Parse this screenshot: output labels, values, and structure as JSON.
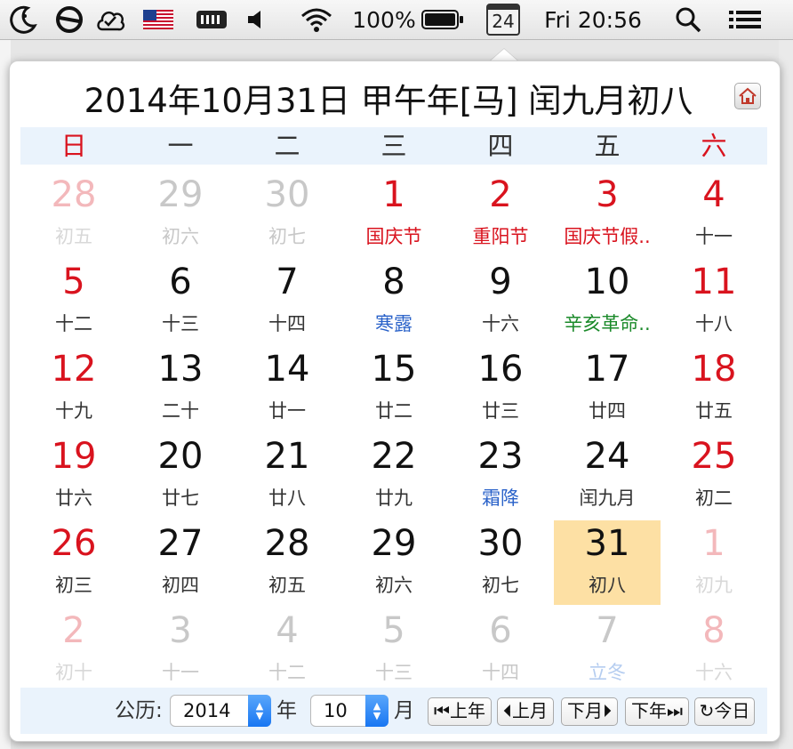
{
  "menubar": {
    "battery_percent": "100%",
    "calendar_icon_day": "24",
    "clock": "Fri 20:56"
  },
  "popup": {
    "title": "2014年10月31日 甲午年[马] 闰九月初八"
  },
  "weekdays": [
    "日",
    "一",
    "二",
    "三",
    "四",
    "五",
    "六"
  ],
  "weeks": [
    [
      {
        "day": "28",
        "lunar": "初五",
        "type": "other red"
      },
      {
        "day": "29",
        "lunar": "初六",
        "type": "other"
      },
      {
        "day": "30",
        "lunar": "初七",
        "type": "other"
      },
      {
        "day": "1",
        "lunar": "国庆节",
        "type": "red hol"
      },
      {
        "day": "2",
        "lunar": "重阳节",
        "type": "red hol"
      },
      {
        "day": "3",
        "lunar": "国庆节假..",
        "type": "red hol"
      },
      {
        "day": "4",
        "lunar": "十一",
        "type": "red"
      }
    ],
    [
      {
        "day": "5",
        "lunar": "十二",
        "type": "red"
      },
      {
        "day": "6",
        "lunar": "十三",
        "type": ""
      },
      {
        "day": "7",
        "lunar": "十四",
        "type": ""
      },
      {
        "day": "8",
        "lunar": "寒露",
        "type": "term"
      },
      {
        "day": "9",
        "lunar": "十六",
        "type": ""
      },
      {
        "day": "10",
        "lunar": "辛亥革命..",
        "type": "fest"
      },
      {
        "day": "11",
        "lunar": "十八",
        "type": "red"
      }
    ],
    [
      {
        "day": "12",
        "lunar": "十九",
        "type": "red"
      },
      {
        "day": "13",
        "lunar": "二十",
        "type": ""
      },
      {
        "day": "14",
        "lunar": "廿一",
        "type": ""
      },
      {
        "day": "15",
        "lunar": "廿二",
        "type": ""
      },
      {
        "day": "16",
        "lunar": "廿三",
        "type": ""
      },
      {
        "day": "17",
        "lunar": "廿四",
        "type": ""
      },
      {
        "day": "18",
        "lunar": "廿五",
        "type": "red"
      }
    ],
    [
      {
        "day": "19",
        "lunar": "廿六",
        "type": "red"
      },
      {
        "day": "20",
        "lunar": "廿七",
        "type": ""
      },
      {
        "day": "21",
        "lunar": "廿八",
        "type": ""
      },
      {
        "day": "22",
        "lunar": "廿九",
        "type": ""
      },
      {
        "day": "23",
        "lunar": "霜降",
        "type": "term"
      },
      {
        "day": "24",
        "lunar": "闰九月",
        "type": ""
      },
      {
        "day": "25",
        "lunar": "初二",
        "type": "red"
      }
    ],
    [
      {
        "day": "26",
        "lunar": "初三",
        "type": "red"
      },
      {
        "day": "27",
        "lunar": "初四",
        "type": ""
      },
      {
        "day": "28",
        "lunar": "初五",
        "type": ""
      },
      {
        "day": "29",
        "lunar": "初六",
        "type": ""
      },
      {
        "day": "30",
        "lunar": "初七",
        "type": ""
      },
      {
        "day": "31",
        "lunar": "初八",
        "type": "sel"
      },
      {
        "day": "1",
        "lunar": "初九",
        "type": "other red"
      }
    ],
    [
      {
        "day": "2",
        "lunar": "初十",
        "type": "other red"
      },
      {
        "day": "3",
        "lunar": "十一",
        "type": "other"
      },
      {
        "day": "4",
        "lunar": "十二",
        "type": "other"
      },
      {
        "day": "5",
        "lunar": "十三",
        "type": "other"
      },
      {
        "day": "6",
        "lunar": "十四",
        "type": "other"
      },
      {
        "day": "7",
        "lunar": "立冬",
        "type": "other term"
      },
      {
        "day": "8",
        "lunar": "十六",
        "type": "other red"
      }
    ]
  ],
  "footer": {
    "calendar_label": "公历:",
    "year_value": "2014",
    "year_unit": "年",
    "month_value": "10",
    "month_unit": "月",
    "prev_year": "上年",
    "prev_month": "上月",
    "next_month": "下月",
    "next_year": "下年",
    "today": "今日"
  }
}
